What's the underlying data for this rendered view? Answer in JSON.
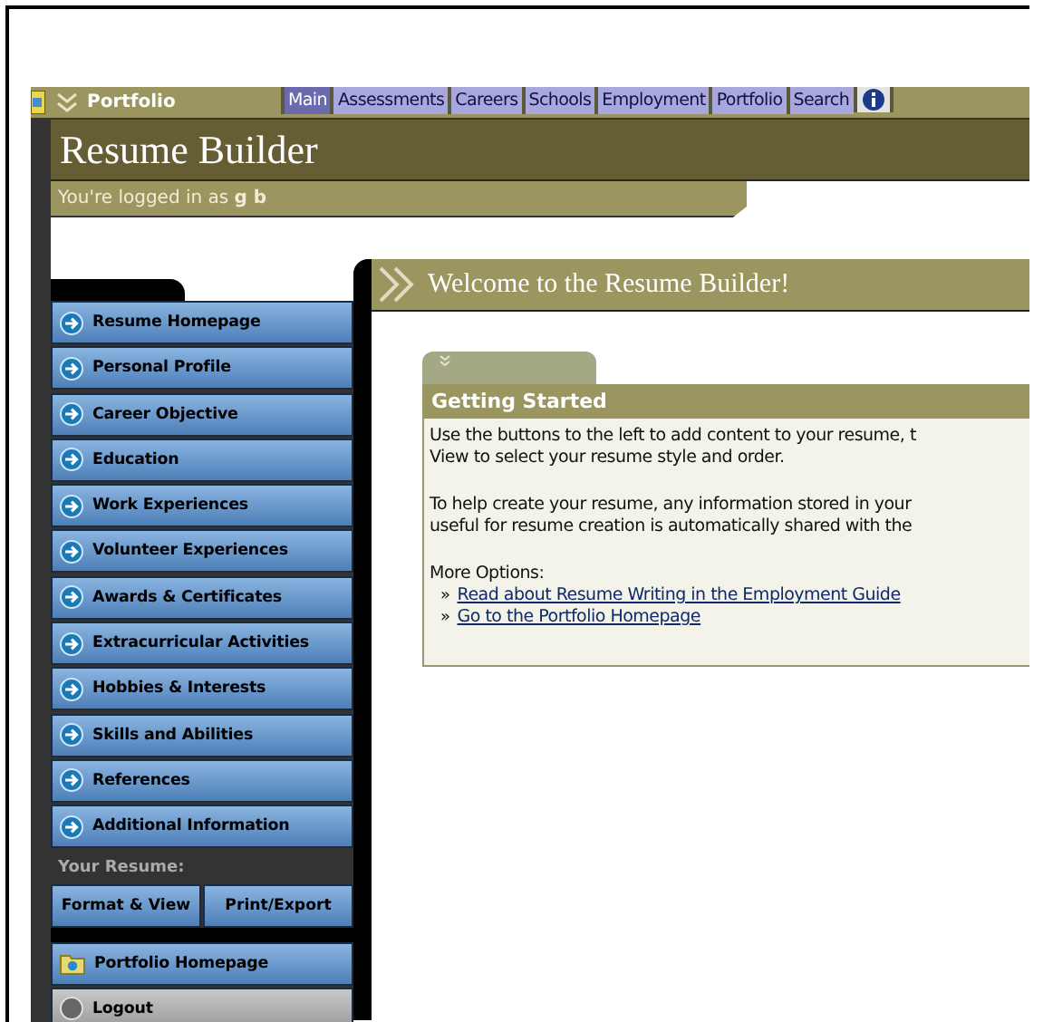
{
  "topbar": {
    "section": "Portfolio",
    "tabs": [
      {
        "label": "Main",
        "selected": true
      },
      {
        "label": "Assessments",
        "selected": false
      },
      {
        "label": "Careers",
        "selected": false
      },
      {
        "label": "Schools",
        "selected": false
      },
      {
        "label": "Employment",
        "selected": false
      },
      {
        "label": "Portfolio",
        "selected": false
      },
      {
        "label": "Search",
        "selected": false
      }
    ]
  },
  "header": {
    "title": "Resume Builder",
    "login": "You're logged in as **g b**"
  },
  "sidebar": {
    "items": [
      {
        "label": "Resume Homepage"
      },
      {
        "label": "Personal Profile"
      },
      {
        "label": "Career Objective"
      },
      {
        "label": "Education"
      },
      {
        "label": "Work Experiences"
      },
      {
        "label": "Volunteer Experiences"
      },
      {
        "label": "Awards & Certificates"
      },
      {
        "label": "Extracurricular Activities"
      },
      {
        "label": "Hobbies & Interests"
      },
      {
        "label": "Skills and Abilities"
      },
      {
        "label": "References"
      },
      {
        "label": "Additional Information"
      }
    ],
    "resume_heading": "Your Resume:",
    "resume_buttons": [
      "Format & View",
      "Print/Export"
    ],
    "bottom_items": [
      {
        "kind": "portfolio",
        "label": "Portfolio Homepage"
      },
      {
        "kind": "logout",
        "label": "Logout"
      }
    ]
  },
  "main": {
    "title": "Welcome to the Resume Builder!",
    "panel": {
      "title": "Getting Started",
      "paragraphs": [
        [
          "Use the buttons to the left to add content to your resume, t",
          "View to select your resume style and order."
        ],
        [
          "To help create your resume, any information stored in your",
          "useful for resume creation is automatically shared with the"
        ]
      ],
      "options_label": "More Options:",
      "links": [
        "Read about Resume Writing in the Employment Guide",
        "Go to the Portfolio Homepage"
      ],
      "link_bullet": "»"
    }
  }
}
